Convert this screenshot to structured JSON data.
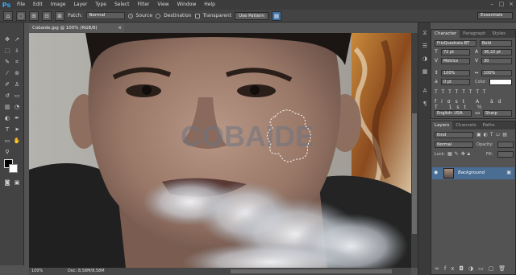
{
  "app": {
    "logo": "Ps"
  },
  "menu": [
    "File",
    "Edit",
    "Image",
    "Layer",
    "Type",
    "Select",
    "Filter",
    "View",
    "Window",
    "Help"
  ],
  "options": {
    "patch_label": "Patch:",
    "patch_mode": "Normal",
    "source": "Source",
    "destination": "Destination",
    "transparent": "Transparent",
    "use_pattern": "Use Pattern",
    "workspace": "Essentials"
  },
  "document": {
    "tab_title": "Cobaide.jpg @ 100% (RGB/8)",
    "zoom": "100%",
    "doc_size": "Doc: 8,58M/8,58M",
    "watermark": "COBAIDE"
  },
  "character": {
    "tabs": [
      "Character",
      "Paragraph",
      "Styles"
    ],
    "font_family": "FrizQuadrata BT",
    "font_style": "Bold",
    "font_size": "72 pt",
    "leading": "36,22 pt",
    "kerning": "Metrics",
    "tracking": "30",
    "vscale": "100%",
    "hscale": "100%",
    "baseline": "0 pt",
    "color_label": "Color:",
    "language": "English: USA",
    "antialias_label": "aa",
    "antialias": "Sharp"
  },
  "layers": {
    "tabs": [
      "Layers",
      "Channels",
      "Paths"
    ],
    "kind": "Kind",
    "blend_mode": "Normal",
    "opacity_label": "Opacity:",
    "lock_label": "Lock:",
    "fill_label": "Fill:",
    "items": [
      {
        "name": "Background"
      }
    ]
  }
}
